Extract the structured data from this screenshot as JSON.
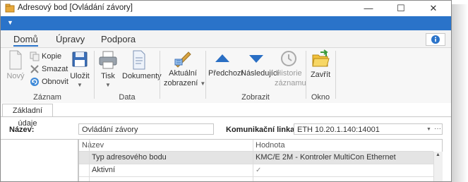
{
  "window": {
    "title": "Adresový bod [Ovládání závory]",
    "minimize": "—",
    "maximize": "☐",
    "close": "✕"
  },
  "qat": {
    "dropdown": "▼"
  },
  "ribbon_tabs": [
    "Domů",
    "Úpravy",
    "Podpora"
  ],
  "help_icon": "info-icon",
  "groups": {
    "zaznam": {
      "label": "Záznam",
      "novy": "Nový",
      "kopie": "Kopie",
      "smazat": "Smazat",
      "obnovit": "Obnovit",
      "ulozit": "Uložit"
    },
    "data": {
      "label": "Data",
      "tisk": "Tisk",
      "dokumenty": "Dokumenty"
    },
    "zobrazeni": {
      "aktualni_1": "Aktuální",
      "aktualni_2": "zobrazení"
    },
    "zobrazit": {
      "label": "Zobrazit",
      "predchozi": "Předchozí",
      "nasledujici": "Následující",
      "historie_1": "Historie",
      "historie_2": "záznamu"
    },
    "okno": {
      "label": "Okno",
      "zavrit": "Zavřít"
    }
  },
  "doc_tab": "Základní údaje",
  "form": {
    "nazev_label": "Název:",
    "nazev_value": "Ovládání závory",
    "komunikacni_label": "Komunikační linka:",
    "komunikacni_value": "ETH 10.20.1.140:14001",
    "more": "···"
  },
  "grid": {
    "headers": [
      "Název",
      "Hodnota"
    ],
    "rows": [
      {
        "name": "Typ adresového bodu",
        "value": "KMC/E 2M - Kontroler MultiCon Ethernet"
      },
      {
        "name": "Aktivní",
        "value": "✓"
      }
    ],
    "scroll_up": "▲"
  },
  "colors": {
    "accent": "#2a73c9",
    "triangle": "#2a6fc4"
  }
}
